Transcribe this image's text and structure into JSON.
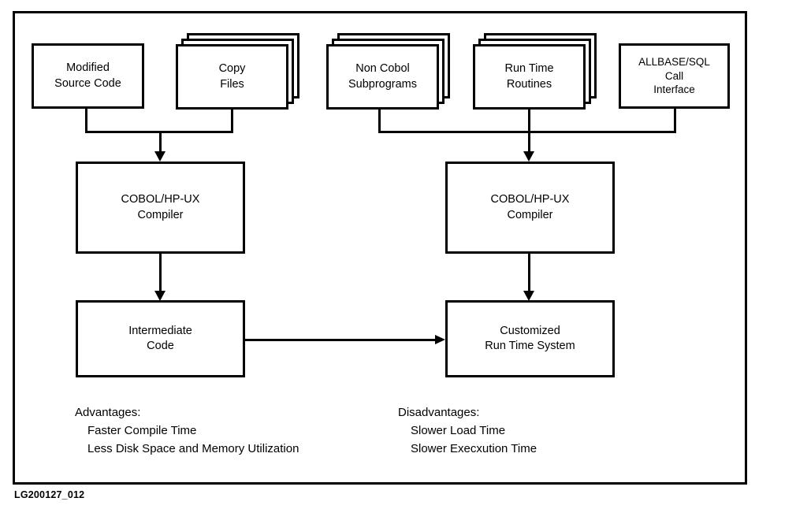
{
  "diagram": {
    "caption": "LG200127_012",
    "nodes": {
      "modified_source_code": {
        "lines": [
          "Modified",
          "Source Code"
        ]
      },
      "copy_files": {
        "lines": [
          "Copy",
          "Files"
        ]
      },
      "non_cobol_subprograms": {
        "lines": [
          "Non Cobol",
          "Subprograms"
        ]
      },
      "run_time_routines": {
        "lines": [
          "Run Time",
          "Routines"
        ]
      },
      "allbase_sql_call_interface": {
        "lines": [
          "ALLBASE/SQL",
          "Call",
          "Interface"
        ]
      },
      "compiler_left": {
        "lines": [
          "COBOL/HP-UX",
          "Compiler"
        ]
      },
      "compiler_right": {
        "lines": [
          "COBOL/HP-UX",
          "Compiler"
        ]
      },
      "intermediate_code": {
        "lines": [
          "Intermediate",
          "Code"
        ]
      },
      "customized_run_time_system": {
        "lines": [
          "Customized",
          "Run Time System"
        ]
      }
    },
    "notes": {
      "advantages": {
        "heading": "Advantages:",
        "items": [
          "Faster Compile Time",
          "Less Disk Space and Memory Utilization"
        ]
      },
      "disadvantages": {
        "heading": "Disadvantages:",
        "items": [
          "Slower Load Time",
          "Slower Execxution Time"
        ]
      }
    },
    "colors": {
      "ink": "#000000",
      "paper": "#ffffff"
    }
  }
}
